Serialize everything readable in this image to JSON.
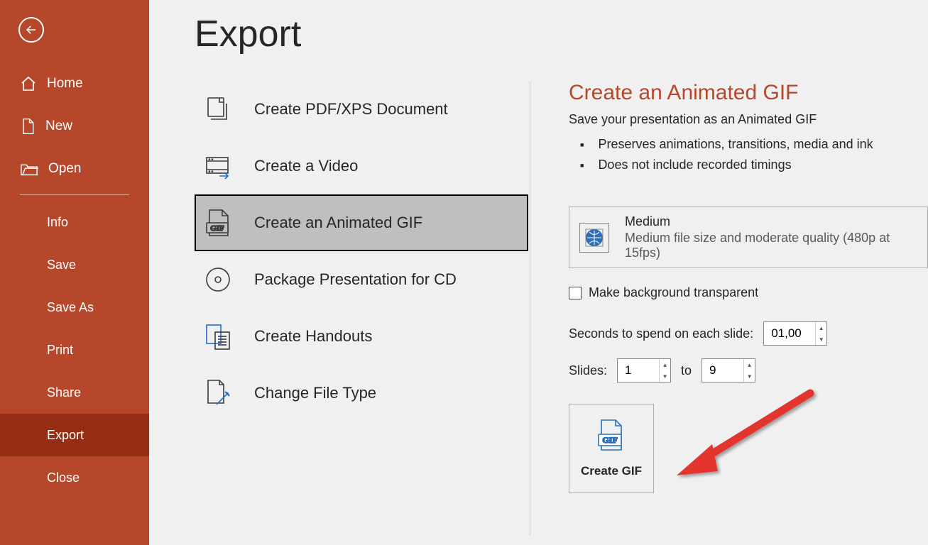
{
  "sidebar": {
    "items": [
      {
        "label": "Home"
      },
      {
        "label": "New"
      },
      {
        "label": "Open"
      }
    ],
    "sub_items": [
      {
        "label": "Info"
      },
      {
        "label": "Save"
      },
      {
        "label": "Save As"
      },
      {
        "label": "Print"
      },
      {
        "label": "Share"
      },
      {
        "label": "Export"
      },
      {
        "label": "Close"
      }
    ]
  },
  "page": {
    "title": "Export"
  },
  "export_types": [
    {
      "label": "Create PDF/XPS Document"
    },
    {
      "label": "Create a Video"
    },
    {
      "label": "Create an Animated GIF"
    },
    {
      "label": "Package Presentation for CD"
    },
    {
      "label": "Create Handouts"
    },
    {
      "label": "Change File Type"
    }
  ],
  "panel": {
    "title": "Create an Animated GIF",
    "subtitle": "Save your presentation as an Animated GIF",
    "bullets": [
      "Preserves animations, transitions, media and ink",
      "Does not include recorded timings"
    ],
    "quality": {
      "label": "Medium",
      "desc": "Medium file size and moderate quality (480p at 15fps)"
    },
    "transparent_label": "Make background transparent",
    "seconds_label": "Seconds to spend on each slide:",
    "seconds_value": "01,00",
    "slides_label": "Slides:",
    "slides_from": "1",
    "slides_to_label": "to",
    "slides_to": "9",
    "create_button": "Create GIF",
    "gif_badge": "GIF"
  }
}
